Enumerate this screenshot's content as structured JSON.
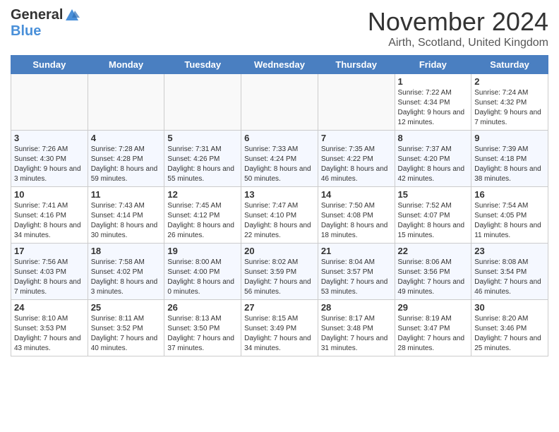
{
  "logo": {
    "general": "General",
    "blue": "Blue"
  },
  "title": "November 2024",
  "location": "Airth, Scotland, United Kingdom",
  "headers": [
    "Sunday",
    "Monday",
    "Tuesday",
    "Wednesday",
    "Thursday",
    "Friday",
    "Saturday"
  ],
  "weeks": [
    [
      {
        "day": "",
        "info": ""
      },
      {
        "day": "",
        "info": ""
      },
      {
        "day": "",
        "info": ""
      },
      {
        "day": "",
        "info": ""
      },
      {
        "day": "",
        "info": ""
      },
      {
        "day": "1",
        "info": "Sunrise: 7:22 AM\nSunset: 4:34 PM\nDaylight: 9 hours and 12 minutes."
      },
      {
        "day": "2",
        "info": "Sunrise: 7:24 AM\nSunset: 4:32 PM\nDaylight: 9 hours and 7 minutes."
      }
    ],
    [
      {
        "day": "3",
        "info": "Sunrise: 7:26 AM\nSunset: 4:30 PM\nDaylight: 9 hours and 3 minutes."
      },
      {
        "day": "4",
        "info": "Sunrise: 7:28 AM\nSunset: 4:28 PM\nDaylight: 8 hours and 59 minutes."
      },
      {
        "day": "5",
        "info": "Sunrise: 7:31 AM\nSunset: 4:26 PM\nDaylight: 8 hours and 55 minutes."
      },
      {
        "day": "6",
        "info": "Sunrise: 7:33 AM\nSunset: 4:24 PM\nDaylight: 8 hours and 50 minutes."
      },
      {
        "day": "7",
        "info": "Sunrise: 7:35 AM\nSunset: 4:22 PM\nDaylight: 8 hours and 46 minutes."
      },
      {
        "day": "8",
        "info": "Sunrise: 7:37 AM\nSunset: 4:20 PM\nDaylight: 8 hours and 42 minutes."
      },
      {
        "day": "9",
        "info": "Sunrise: 7:39 AM\nSunset: 4:18 PM\nDaylight: 8 hours and 38 minutes."
      }
    ],
    [
      {
        "day": "10",
        "info": "Sunrise: 7:41 AM\nSunset: 4:16 PM\nDaylight: 8 hours and 34 minutes."
      },
      {
        "day": "11",
        "info": "Sunrise: 7:43 AM\nSunset: 4:14 PM\nDaylight: 8 hours and 30 minutes."
      },
      {
        "day": "12",
        "info": "Sunrise: 7:45 AM\nSunset: 4:12 PM\nDaylight: 8 hours and 26 minutes."
      },
      {
        "day": "13",
        "info": "Sunrise: 7:47 AM\nSunset: 4:10 PM\nDaylight: 8 hours and 22 minutes."
      },
      {
        "day": "14",
        "info": "Sunrise: 7:50 AM\nSunset: 4:08 PM\nDaylight: 8 hours and 18 minutes."
      },
      {
        "day": "15",
        "info": "Sunrise: 7:52 AM\nSunset: 4:07 PM\nDaylight: 8 hours and 15 minutes."
      },
      {
        "day": "16",
        "info": "Sunrise: 7:54 AM\nSunset: 4:05 PM\nDaylight: 8 hours and 11 minutes."
      }
    ],
    [
      {
        "day": "17",
        "info": "Sunrise: 7:56 AM\nSunset: 4:03 PM\nDaylight: 8 hours and 7 minutes."
      },
      {
        "day": "18",
        "info": "Sunrise: 7:58 AM\nSunset: 4:02 PM\nDaylight: 8 hours and 3 minutes."
      },
      {
        "day": "19",
        "info": "Sunrise: 8:00 AM\nSunset: 4:00 PM\nDaylight: 8 hours and 0 minutes."
      },
      {
        "day": "20",
        "info": "Sunrise: 8:02 AM\nSunset: 3:59 PM\nDaylight: 7 hours and 56 minutes."
      },
      {
        "day": "21",
        "info": "Sunrise: 8:04 AM\nSunset: 3:57 PM\nDaylight: 7 hours and 53 minutes."
      },
      {
        "day": "22",
        "info": "Sunrise: 8:06 AM\nSunset: 3:56 PM\nDaylight: 7 hours and 49 minutes."
      },
      {
        "day": "23",
        "info": "Sunrise: 8:08 AM\nSunset: 3:54 PM\nDaylight: 7 hours and 46 minutes."
      }
    ],
    [
      {
        "day": "24",
        "info": "Sunrise: 8:10 AM\nSunset: 3:53 PM\nDaylight: 7 hours and 43 minutes."
      },
      {
        "day": "25",
        "info": "Sunrise: 8:11 AM\nSunset: 3:52 PM\nDaylight: 7 hours and 40 minutes."
      },
      {
        "day": "26",
        "info": "Sunrise: 8:13 AM\nSunset: 3:50 PM\nDaylight: 7 hours and 37 minutes."
      },
      {
        "day": "27",
        "info": "Sunrise: 8:15 AM\nSunset: 3:49 PM\nDaylight: 7 hours and 34 minutes."
      },
      {
        "day": "28",
        "info": "Sunrise: 8:17 AM\nSunset: 3:48 PM\nDaylight: 7 hours and 31 minutes."
      },
      {
        "day": "29",
        "info": "Sunrise: 8:19 AM\nSunset: 3:47 PM\nDaylight: 7 hours and 28 minutes."
      },
      {
        "day": "30",
        "info": "Sunrise: 8:20 AM\nSunset: 3:46 PM\nDaylight: 7 hours and 25 minutes."
      }
    ]
  ]
}
